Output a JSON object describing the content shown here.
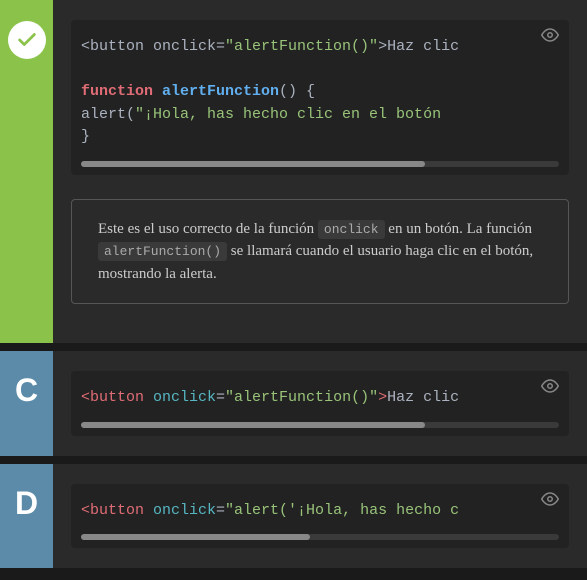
{
  "options": {
    "correct": {
      "code": {
        "line1_prefix": "<button onclick=",
        "line1_value": "\"alertFunction()\"",
        "line1_suffix": ">Haz clic",
        "line3_keyword": "function",
        "line3_name": " alertFunction",
        "line3_params": "() {",
        "line4_indent": "  alert(",
        "line4_str": "\"¡Hola, has hecho clic en el botón",
        "line5": "}"
      },
      "explanation": {
        "part1": "Este es el uso correcto de la función ",
        "code1": "onclick",
        "part2": " en un botón. La función ",
        "code2": "alertFunction()",
        "part3": " se llamará cuando el usuario haga clic en el botón, mostrando la alerta."
      },
      "scrollbar_width": "72%"
    },
    "c": {
      "letter": "C",
      "code": {
        "tag": "<button",
        "attr": " onclick",
        "eq": "=",
        "value": "\"alertFunction()\"",
        "close": ">",
        "text": "Haz clic"
      },
      "scrollbar_width": "72%"
    },
    "d": {
      "letter": "D",
      "code": {
        "tag": "<button",
        "attr": " onclick",
        "eq": "=",
        "value": "\"alert('¡Hola, has hecho c"
      },
      "scrollbar_width": "48%"
    }
  },
  "colors": {
    "correct_bg": "#8bc34a",
    "option_bg": "#5b8ba8"
  }
}
